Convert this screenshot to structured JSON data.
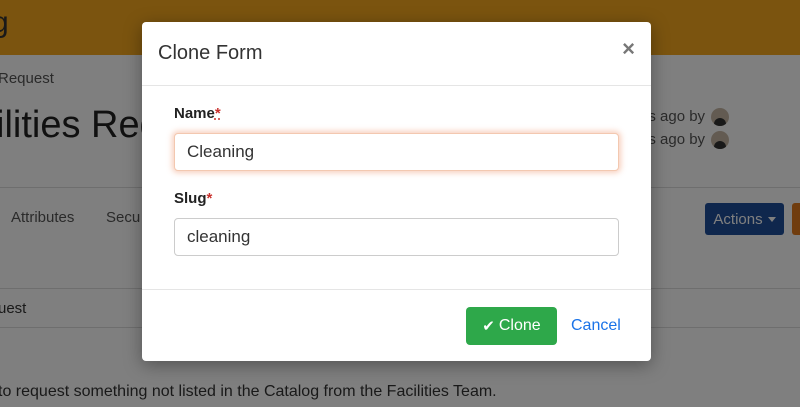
{
  "background": {
    "brand_fragment": "g",
    "breadcrumb": "Request",
    "page_title": "ilities Req",
    "meta_1": "ns ago by",
    "meta_2": "ns ago by",
    "tabs": [
      "Attributes",
      "Secu"
    ],
    "actions_label": "Actions",
    "section_label": "uest",
    "description": "to request something not listed in the Catalog from the Facilities Team."
  },
  "modal": {
    "title": "Clone Form",
    "close_symbol": "×",
    "name_label": "Name",
    "name_required": "*",
    "name_value": "Cleaning",
    "slug_label": "Slug",
    "slug_required": "*",
    "slug_value": "cleaning",
    "clone_label": "Clone",
    "clone_icon": "check-icon",
    "cancel_label": "Cancel"
  },
  "colors": {
    "topbar": "#f6a81f",
    "actions_button": "#1f4e9a",
    "clone_button": "#2ea84a",
    "required_star": "#c9302c",
    "cancel_link": "#1a73e8"
  }
}
